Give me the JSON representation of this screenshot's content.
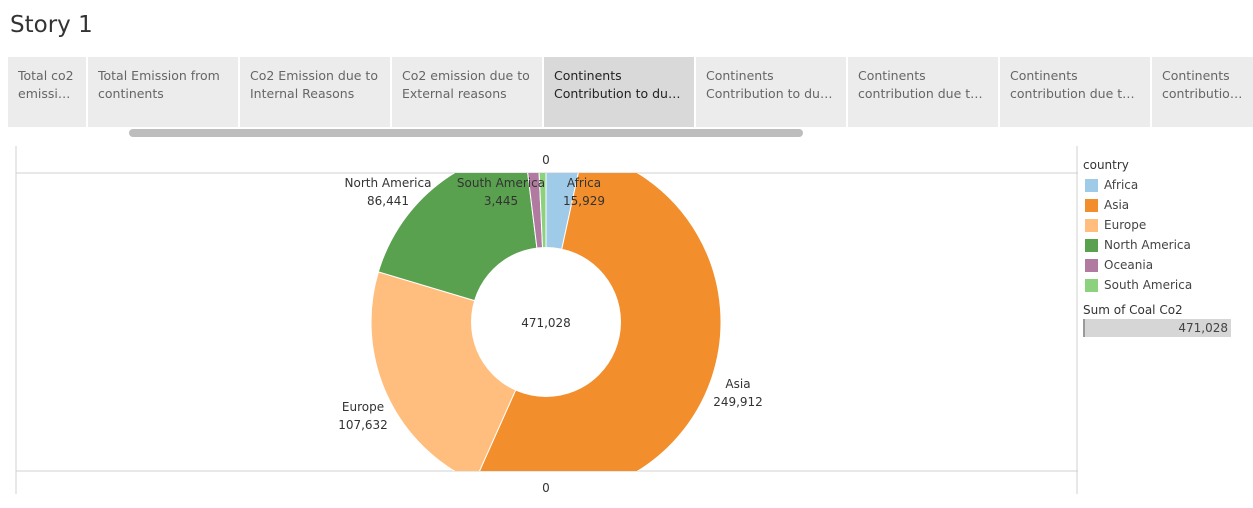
{
  "story": {
    "title": "Story 1"
  },
  "tabs": [
    {
      "line1": "Total co2",
      "line2": "emission f..",
      "selected": false
    },
    {
      "line1": "Total Emission from",
      "line2": "continents",
      "selected": false
    },
    {
      "line1": "Co2 Emission due to",
      "line2": "Internal Reasons",
      "selected": false
    },
    {
      "line1": "Co2 emission due to",
      "line2": "External reasons",
      "selected": false
    },
    {
      "line1": "Continents",
      "line2": "Contribution to due c..",
      "selected": true
    },
    {
      "line1": "Continents",
      "line2": "Contribution to due C..",
      "selected": false
    },
    {
      "line1": "Continents",
      "line2": "contribution due to G..",
      "selected": false
    },
    {
      "line1": "Continents",
      "line2": "contribution due to fl..",
      "selected": false
    },
    {
      "line1": "Continents",
      "line2": "contribution ..",
      "selected": false
    }
  ],
  "chart_data": {
    "type": "pie",
    "donut": true,
    "center_label": "471,028",
    "axis_top_label": "0",
    "axis_bottom_label": "0",
    "slices": [
      {
        "name": "Africa",
        "value": 15929,
        "label": "15,929",
        "color": "#a0cbe8"
      },
      {
        "name": "Asia",
        "value": 249912,
        "label": "249,912",
        "color": "#f28e2b"
      },
      {
        "name": "Europe",
        "value": 107632,
        "label": "107,632",
        "color": "#ffbe7d"
      },
      {
        "name": "North America",
        "value": 86441,
        "label": "86,441",
        "color": "#59a14f"
      },
      {
        "name": "Oceania",
        "value": 5669,
        "label": "",
        "color": "#b07aa1"
      },
      {
        "name": "South America",
        "value": 3445,
        "label": "3,445",
        "color": "#8cd17d"
      }
    ]
  },
  "legend": {
    "title": "country",
    "items": [
      {
        "label": "Africa",
        "color": "#a0cbe8"
      },
      {
        "label": "Asia",
        "color": "#f28e2b"
      },
      {
        "label": "Europe",
        "color": "#ffbe7d"
      },
      {
        "label": "North America",
        "color": "#59a14f"
      },
      {
        "label": "Oceania",
        "color": "#b07aa1"
      },
      {
        "label": "South America",
        "color": "#8cd17d"
      }
    ],
    "size_title": "Sum of Coal Co2",
    "size_value": "471,028"
  }
}
